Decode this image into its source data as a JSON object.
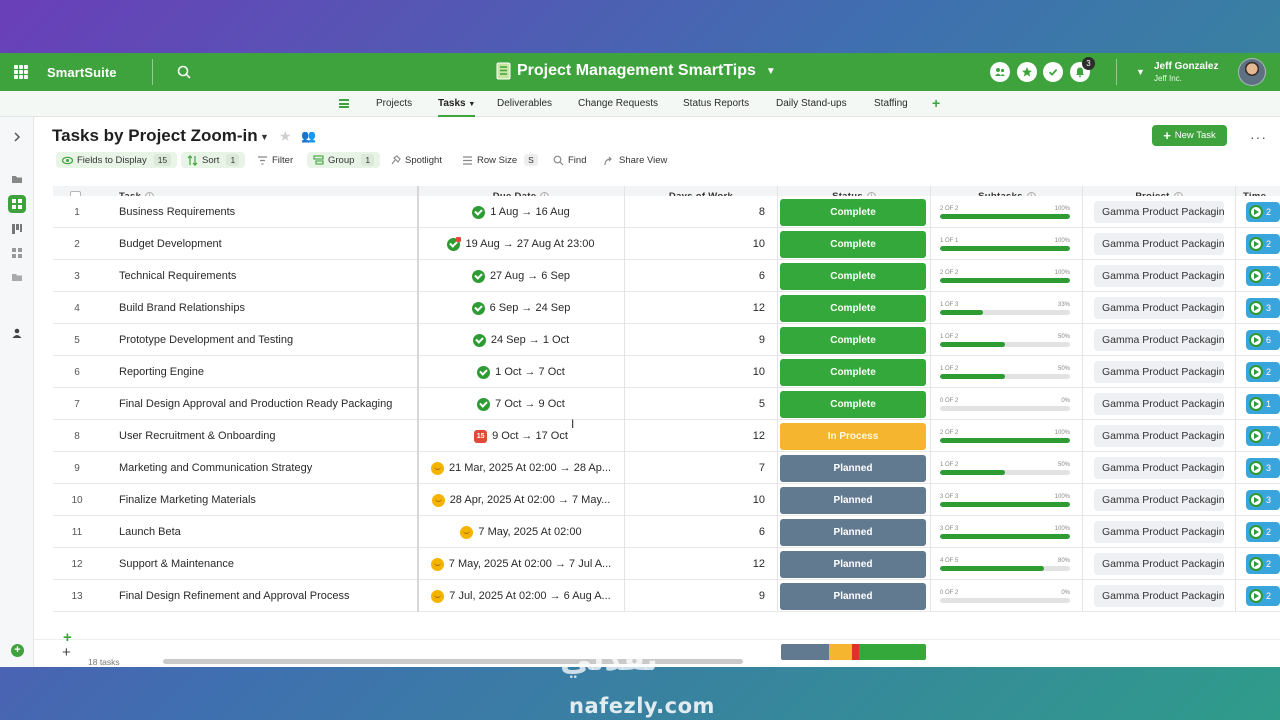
{
  "app": {
    "brand": "SmartSuite",
    "solution_title": "Project Management SmartTips",
    "notification_count": "3",
    "user": {
      "name": "Jeff Gonzalez",
      "company": "Jeff Inc."
    }
  },
  "nav": {
    "tabs": [
      {
        "label": "Projects"
      },
      {
        "label": "Tasks",
        "active": true
      },
      {
        "label": "Deliverables"
      },
      {
        "label": "Change Requests"
      },
      {
        "label": "Status Reports"
      },
      {
        "label": "Daily Stand-ups"
      },
      {
        "label": "Staffing"
      }
    ]
  },
  "view": {
    "title": "Tasks by Project Zoom-in",
    "new_task_label": "New Task"
  },
  "toolbar": {
    "fields_label": "Fields to Display",
    "fields_count": "15",
    "sort_label": "Sort",
    "sort_count": "1",
    "filter_label": "Filter",
    "group_label": "Group",
    "group_count": "1",
    "spotlight_label": "Spotlight",
    "rowsize_label": "Row Size",
    "rowsize_value": "S",
    "find_label": "Find",
    "share_label": "Share View"
  },
  "table": {
    "columns": {
      "task": "Task",
      "due_date": "Due Date",
      "days": "Days of Work",
      "status": "Status",
      "subtasks": "Subtasks",
      "project": "Project",
      "time": "Time"
    },
    "rows": [
      {
        "num": "1",
        "task": "Business Requirements",
        "due": "1 Aug → 16 Aug",
        "due_icon": "check",
        "days": "8",
        "status": "Complete",
        "sub_count": "2 OF 2",
        "sub_pct": "100%",
        "sub_fill": 1.0,
        "project": "Gamma Product Packaging",
        "time_value": "2"
      },
      {
        "num": "2",
        "task": "Budget Development",
        "due": "19 Aug → 27 Aug At 23:00",
        "due_icon": "check-red",
        "days": "10",
        "status": "Complete",
        "sub_count": "1 OF 1",
        "sub_pct": "100%",
        "sub_fill": 1.0,
        "project": "Gamma Product Packaging",
        "time_value": "2"
      },
      {
        "num": "3",
        "task": "Technical Requirements",
        "due": "27 Aug → 6 Sep",
        "due_icon": "check",
        "days": "6",
        "status": "Complete",
        "sub_count": "2 OF 2",
        "sub_pct": "100%",
        "sub_fill": 1.0,
        "project": "Gamma Product Packaging",
        "time_value": "2"
      },
      {
        "num": "4",
        "task": "Build Brand Relationships",
        "due": "6 Sep → 24 Sep",
        "due_icon": "check",
        "days": "12",
        "status": "Complete",
        "sub_count": "1 OF 3",
        "sub_pct": "33%",
        "sub_fill": 0.33,
        "project": "Gamma Product Packaging",
        "time_value": "3"
      },
      {
        "num": "5",
        "task": "Prototype Development and Testing",
        "due": "24 Sep → 1 Oct",
        "due_icon": "check",
        "days": "9",
        "status": "Complete",
        "sub_count": "1 OF 2",
        "sub_pct": "50%",
        "sub_fill": 0.5,
        "project": "Gamma Product Packaging",
        "time_value": "6"
      },
      {
        "num": "6",
        "task": "Reporting Engine",
        "due": "1 Oct → 7 Oct",
        "due_icon": "check",
        "days": "10",
        "status": "Complete",
        "sub_count": "1 OF 2",
        "sub_pct": "50%",
        "sub_fill": 0.5,
        "project": "Gamma Product Packaging",
        "time_value": "2"
      },
      {
        "num": "7",
        "task": "Final Design Approval and Production Ready Packaging",
        "due": "7 Oct → 9 Oct",
        "due_icon": "check",
        "days": "5",
        "status": "Complete",
        "sub_count": "0 OF 2",
        "sub_pct": "0%",
        "sub_fill": 0.0,
        "project": "Gamma Product Packaging",
        "time_value": "1"
      },
      {
        "num": "8",
        "task": "User Recruitment & Onboarding",
        "due": "9 Oct → 17 Oct",
        "due_icon": "calendar",
        "due_icon_text": "15",
        "days": "12",
        "status": "In Process",
        "sub_count": "2 OF 2",
        "sub_pct": "100%",
        "sub_fill": 1.0,
        "project": "Gamma Product Packaging",
        "time_value": "7"
      },
      {
        "num": "9",
        "task": "Marketing and Communication Strategy",
        "due": "21 Mar, 2025 At 02:00 → 28 Ap...",
        "due_icon": "face",
        "days": "7",
        "status": "Planned",
        "sub_count": "1 OF 2",
        "sub_pct": "50%",
        "sub_fill": 0.5,
        "project": "Gamma Product Packaging",
        "time_value": "3"
      },
      {
        "num": "10",
        "task": "Finalize Marketing Materials",
        "due": "28 Apr, 2025 At 02:00 → 7 May...",
        "due_icon": "face",
        "days": "10",
        "status": "Planned",
        "sub_count": "3 OF 3",
        "sub_pct": "100%",
        "sub_fill": 1.0,
        "project": "Gamma Product Packaging",
        "time_value": "3"
      },
      {
        "num": "11",
        "task": "Launch Beta",
        "due": "7 May, 2025 At 02:00",
        "due_icon": "face",
        "days": "6",
        "status": "Planned",
        "sub_count": "3 OF 3",
        "sub_pct": "100%",
        "sub_fill": 1.0,
        "project": "Gamma Product Packaging",
        "time_value": "2"
      },
      {
        "num": "12",
        "task": "Support & Maintenance",
        "due": "7 May, 2025 At 02:00 → 7 Jul A...",
        "due_icon": "face",
        "days": "12",
        "status": "Planned",
        "sub_count": "4 OF 5",
        "sub_pct": "80%",
        "sub_fill": 0.8,
        "project": "Gamma Product Packaging",
        "time_value": "2"
      },
      {
        "num": "13",
        "task": "Final Design Refinement and Approval Process",
        "due": "7 Jul, 2025 At 02:00 → 6 Aug A...",
        "due_icon": "face",
        "days": "9",
        "status": "Planned",
        "sub_count": "0 OF 2",
        "sub_pct": "0%",
        "sub_fill": 0.0,
        "project": "Gamma Product Packaging",
        "time_value": "2"
      }
    ]
  },
  "footer": {
    "task_count": "18 tasks",
    "status_summary": [
      {
        "status": "Planned",
        "fraction": 0.33,
        "color": "#627a8f"
      },
      {
        "status": "In Process",
        "fraction": 0.16,
        "color": "#f5b52f"
      },
      {
        "status": "Overdue",
        "fraction": 0.05,
        "color": "#e0312d"
      },
      {
        "status": "Complete",
        "fraction": 0.46,
        "color": "#34a83a"
      }
    ]
  },
  "watermark": {
    "arabic": "نفذلي",
    "latin": "nafezly.com"
  },
  "colors": {
    "brand_green": "#3fa33d",
    "complete": "#34a83a",
    "in_process": "#f5b52f",
    "planned": "#627a8f"
  }
}
